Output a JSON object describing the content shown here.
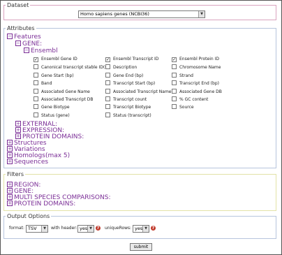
{
  "dataset": {
    "legend": "Dataset",
    "selected": "Homo sapiens genes (NCBI36)"
  },
  "attributes": {
    "legend": "Attributes",
    "features_label": "Features",
    "gene_label": "GENE:",
    "ensembl_label": "Ensembl",
    "grid": [
      [
        {
          "label": "Ensembl Gene ID",
          "checked": true
        },
        {
          "label": "Ensembl Transcript ID",
          "checked": true
        },
        {
          "label": "Ensembl Protein ID",
          "checked": true
        }
      ],
      [
        {
          "label": "Canonical transcript stable ID(s)",
          "checked": false
        },
        {
          "label": "Description",
          "checked": false
        },
        {
          "label": "Chromosome Name",
          "checked": false
        }
      ],
      [
        {
          "label": "Gene Start (bp)",
          "checked": false
        },
        {
          "label": "Gene End (bp)",
          "checked": false
        },
        {
          "label": "Strand",
          "checked": false
        }
      ],
      [
        {
          "label": "Band",
          "checked": false
        },
        {
          "label": "Transcript Start (bp)",
          "checked": false
        },
        {
          "label": "Transcript End (bp)",
          "checked": false
        }
      ],
      [
        {
          "label": "Associated Gene Name",
          "checked": false
        },
        {
          "label": "Associated Transcript Name",
          "checked": false
        },
        {
          "label": "Associated Gene DB",
          "checked": false
        }
      ],
      [
        {
          "label": "Associated Transcript DB",
          "checked": false
        },
        {
          "label": "Transcript count",
          "checked": false
        },
        {
          "label": "% GC content",
          "checked": false
        }
      ],
      [
        {
          "label": "Gene Biotype",
          "checked": false
        },
        {
          "label": "Transcript Biotype",
          "checked": false
        },
        {
          "label": "Source",
          "checked": false
        }
      ],
      [
        {
          "label": "Status (gene)",
          "checked": false
        },
        {
          "label": "Status (transcript)",
          "checked": false
        },
        null
      ]
    ],
    "gene_subsections": [
      "EXTERNAL:",
      "EXPRESSION:",
      "PROTEIN DOMAINS:"
    ],
    "other_sections": [
      "Structures",
      "Variations",
      "Homologs(max 5)",
      "Sequences"
    ]
  },
  "filters": {
    "legend": "Filters",
    "sections": [
      "REGION:",
      "GENE:",
      "MULTI SPECIES COMPARISONS:",
      "PROTEIN DOMAINS:"
    ]
  },
  "output": {
    "legend": "Output Options",
    "format_label": "format:",
    "format_value": "TSV",
    "header_label": "with header:",
    "header_value": "yes",
    "unique_label": "uniqueRows:",
    "unique_value": "yes"
  },
  "submit_label": "submit",
  "icons": {
    "expanded": "minus-icon",
    "collapsed": "plus-icon",
    "help": "help-icon",
    "dropdown": "dropdown-arrow-icon"
  },
  "colors": {
    "section_text": "#7a2d96",
    "dataset_border": "#d9a3bf",
    "filters_border": "#e2e2a6",
    "attributes_border": "#b7c5dd",
    "help_icon": "#c0392b"
  }
}
